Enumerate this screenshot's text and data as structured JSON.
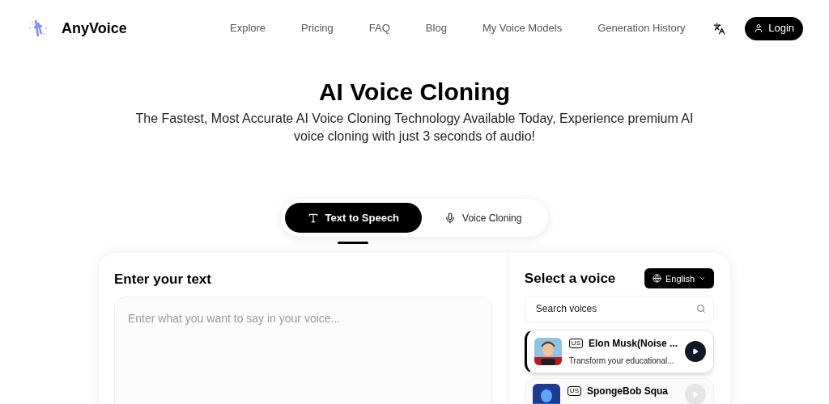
{
  "brand": {
    "name": "AnyVoice"
  },
  "nav": [
    {
      "label": "Explore"
    },
    {
      "label": "Pricing"
    },
    {
      "label": "FAQ"
    },
    {
      "label": "Blog"
    },
    {
      "label": "My Voice Models"
    },
    {
      "label": "Generation History"
    }
  ],
  "login": {
    "label": "Login"
  },
  "hero": {
    "title": "AI Voice Cloning",
    "subtitle": "The Fastest, Most Accurate AI Voice Cloning Technology Available Today, Experience premium AI voice cloning with just 3 seconds of audio!"
  },
  "mode_tabs": [
    {
      "label": "Text to Speech",
      "kind": "text",
      "selected": true
    },
    {
      "label": "Voice Cloning",
      "kind": "mic",
      "selected": false
    }
  ],
  "editor": {
    "heading": "Enter your text",
    "placeholder": "Enter what you want to say in your voice..."
  },
  "voices_panel": {
    "heading": "Select a voice",
    "language": "English",
    "search_placeholder": "Search voices"
  },
  "voices": [
    {
      "region": "US",
      "name": "Elon Musk(Noise ...",
      "description": "Transform your educational...",
      "selected": true
    },
    {
      "region": "US",
      "name": "SpongeBob Squa",
      "selected": false
    }
  ]
}
